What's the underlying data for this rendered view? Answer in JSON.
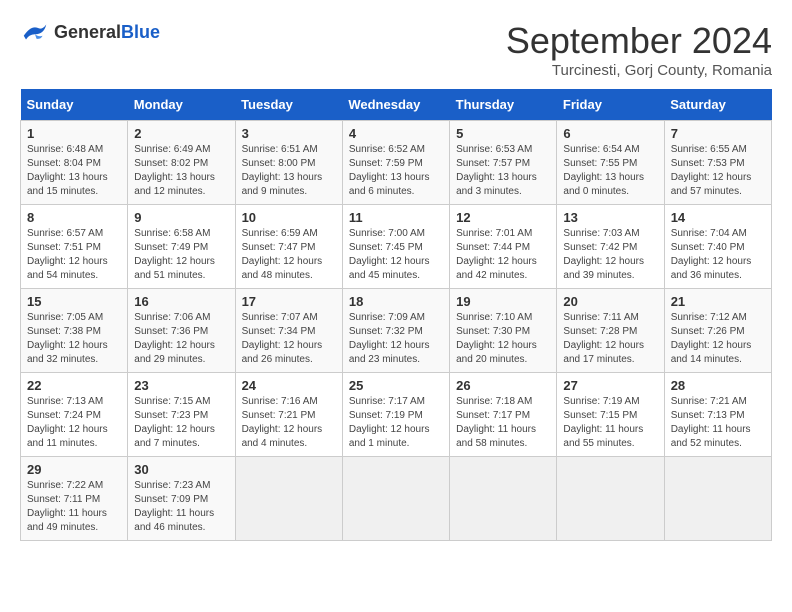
{
  "header": {
    "logo_general": "General",
    "logo_blue": "Blue",
    "month_title": "September 2024",
    "location": "Turcinesti, Gorj County, Romania"
  },
  "weekdays": [
    "Sunday",
    "Monday",
    "Tuesday",
    "Wednesday",
    "Thursday",
    "Friday",
    "Saturday"
  ],
  "weeks": [
    [
      {
        "day": "1",
        "sunrise": "6:48 AM",
        "sunset": "8:04 PM",
        "daylight": "13 hours and 15 minutes."
      },
      {
        "day": "2",
        "sunrise": "6:49 AM",
        "sunset": "8:02 PM",
        "daylight": "13 hours and 12 minutes."
      },
      {
        "day": "3",
        "sunrise": "6:51 AM",
        "sunset": "8:00 PM",
        "daylight": "13 hours and 9 minutes."
      },
      {
        "day": "4",
        "sunrise": "6:52 AM",
        "sunset": "7:59 PM",
        "daylight": "13 hours and 6 minutes."
      },
      {
        "day": "5",
        "sunrise": "6:53 AM",
        "sunset": "7:57 PM",
        "daylight": "13 hours and 3 minutes."
      },
      {
        "day": "6",
        "sunrise": "6:54 AM",
        "sunset": "7:55 PM",
        "daylight": "13 hours and 0 minutes."
      },
      {
        "day": "7",
        "sunrise": "6:55 AM",
        "sunset": "7:53 PM",
        "daylight": "12 hours and 57 minutes."
      }
    ],
    [
      {
        "day": "8",
        "sunrise": "6:57 AM",
        "sunset": "7:51 PM",
        "daylight": "12 hours and 54 minutes."
      },
      {
        "day": "9",
        "sunrise": "6:58 AM",
        "sunset": "7:49 PM",
        "daylight": "12 hours and 51 minutes."
      },
      {
        "day": "10",
        "sunrise": "6:59 AM",
        "sunset": "7:47 PM",
        "daylight": "12 hours and 48 minutes."
      },
      {
        "day": "11",
        "sunrise": "7:00 AM",
        "sunset": "7:45 PM",
        "daylight": "12 hours and 45 minutes."
      },
      {
        "day": "12",
        "sunrise": "7:01 AM",
        "sunset": "7:44 PM",
        "daylight": "12 hours and 42 minutes."
      },
      {
        "day": "13",
        "sunrise": "7:03 AM",
        "sunset": "7:42 PM",
        "daylight": "12 hours and 39 minutes."
      },
      {
        "day": "14",
        "sunrise": "7:04 AM",
        "sunset": "7:40 PM",
        "daylight": "12 hours and 36 minutes."
      }
    ],
    [
      {
        "day": "15",
        "sunrise": "7:05 AM",
        "sunset": "7:38 PM",
        "daylight": "12 hours and 32 minutes."
      },
      {
        "day": "16",
        "sunrise": "7:06 AM",
        "sunset": "7:36 PM",
        "daylight": "12 hours and 29 minutes."
      },
      {
        "day": "17",
        "sunrise": "7:07 AM",
        "sunset": "7:34 PM",
        "daylight": "12 hours and 26 minutes."
      },
      {
        "day": "18",
        "sunrise": "7:09 AM",
        "sunset": "7:32 PM",
        "daylight": "12 hours and 23 minutes."
      },
      {
        "day": "19",
        "sunrise": "7:10 AM",
        "sunset": "7:30 PM",
        "daylight": "12 hours and 20 minutes."
      },
      {
        "day": "20",
        "sunrise": "7:11 AM",
        "sunset": "7:28 PM",
        "daylight": "12 hours and 17 minutes."
      },
      {
        "day": "21",
        "sunrise": "7:12 AM",
        "sunset": "7:26 PM",
        "daylight": "12 hours and 14 minutes."
      }
    ],
    [
      {
        "day": "22",
        "sunrise": "7:13 AM",
        "sunset": "7:24 PM",
        "daylight": "12 hours and 11 minutes."
      },
      {
        "day": "23",
        "sunrise": "7:15 AM",
        "sunset": "7:23 PM",
        "daylight": "12 hours and 7 minutes."
      },
      {
        "day": "24",
        "sunrise": "7:16 AM",
        "sunset": "7:21 PM",
        "daylight": "12 hours and 4 minutes."
      },
      {
        "day": "25",
        "sunrise": "7:17 AM",
        "sunset": "7:19 PM",
        "daylight": "12 hours and 1 minute."
      },
      {
        "day": "26",
        "sunrise": "7:18 AM",
        "sunset": "7:17 PM",
        "daylight": "11 hours and 58 minutes."
      },
      {
        "day": "27",
        "sunrise": "7:19 AM",
        "sunset": "7:15 PM",
        "daylight": "11 hours and 55 minutes."
      },
      {
        "day": "28",
        "sunrise": "7:21 AM",
        "sunset": "7:13 PM",
        "daylight": "11 hours and 52 minutes."
      }
    ],
    [
      {
        "day": "29",
        "sunrise": "7:22 AM",
        "sunset": "7:11 PM",
        "daylight": "11 hours and 49 minutes."
      },
      {
        "day": "30",
        "sunrise": "7:23 AM",
        "sunset": "7:09 PM",
        "daylight": "11 hours and 46 minutes."
      },
      null,
      null,
      null,
      null,
      null
    ]
  ]
}
